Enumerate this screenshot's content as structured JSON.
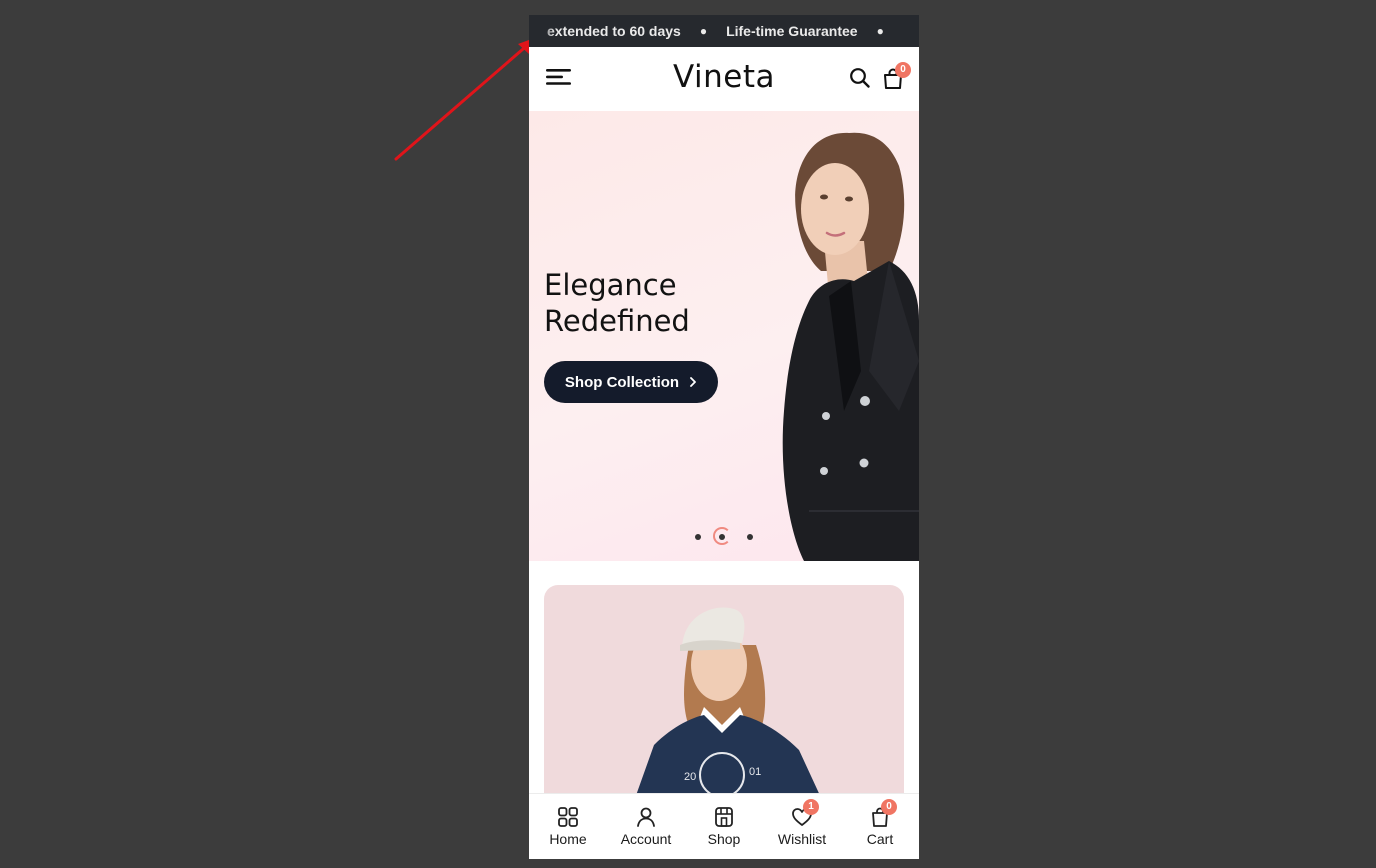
{
  "announcement": {
    "items": [
      "extended to 60 days",
      "Life-time Guarantee"
    ]
  },
  "header": {
    "logo": "Vineta",
    "cart_count": "0",
    "icons": [
      "menu-icon",
      "search-icon",
      "bag-icon"
    ]
  },
  "hero": {
    "title_line1": "Elegance",
    "title_line2": "Redefined",
    "cta_label": "Shop Collection",
    "cta_icon": "chevron-right-icon",
    "slides": 3,
    "active_slide": 2
  },
  "bottom_nav": {
    "items": [
      {
        "label": "Home",
        "icon": "grid-icon"
      },
      {
        "label": "Account",
        "icon": "user-icon"
      },
      {
        "label": "Shop",
        "icon": "store-icon"
      },
      {
        "label": "Wishlist",
        "icon": "heart-icon",
        "badge": "1"
      },
      {
        "label": "Cart",
        "icon": "bag-icon",
        "badge": "0"
      }
    ]
  },
  "colors": {
    "page_bg": "#3c3c3c",
    "announce_bg": "#26292e",
    "hero_bg": "#fdeaea",
    "cta_bg": "#141b2b",
    "badge": "#f07563",
    "arrow": "#e0141a"
  }
}
